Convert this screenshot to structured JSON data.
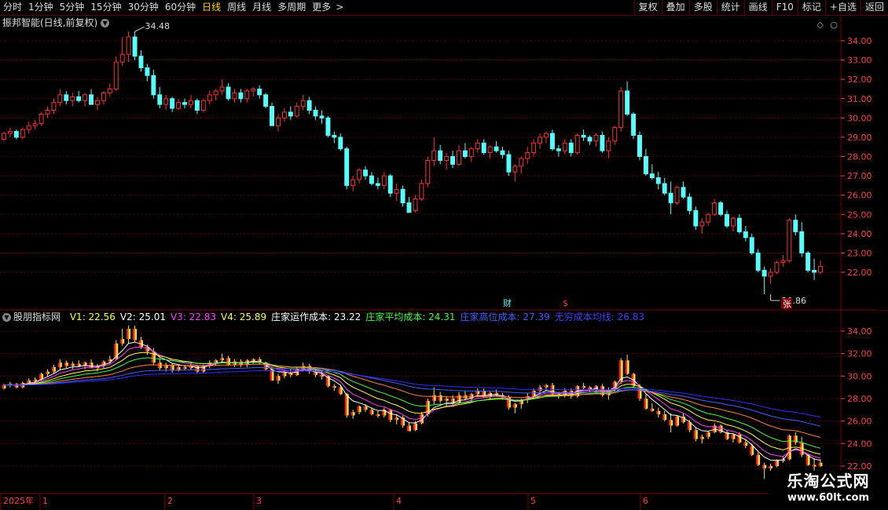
{
  "toolbar": {
    "periods": [
      "分时",
      "1分钟",
      "5分钟",
      "15分钟",
      "30分钟",
      "60分钟",
      "日线",
      "周线",
      "月线",
      "多周期",
      "更多"
    ],
    "active_period": "日线",
    "more_icon": "chevron-right-icon",
    "actions": [
      "复权",
      "叠加",
      "多股",
      "统计",
      "画线",
      "F10",
      "标记",
      "+自选",
      "返回"
    ]
  },
  "main_header": {
    "title": "振邦智能(日线,前复权)",
    "dropdown_icon": "chevron-down-icon"
  },
  "indicator_header": {
    "title": "股朋指标网",
    "items": [
      {
        "label": "V1: 22.56",
        "color": "#ffff40"
      },
      {
        "label": "V2: 25.01",
        "color": "#ffffff"
      },
      {
        "label": "V3: 22.83",
        "color": "#ff40ff"
      },
      {
        "label": "V4: 25.89",
        "color": "#ffff40"
      },
      {
        "label": "庄家运作成本: 23.22",
        "color": "#ffffff"
      },
      {
        "label": "庄家平均成本: 24.31",
        "color": "#40ff40"
      },
      {
        "label": "庄家高位成本: 27.39",
        "color": "#4060ff"
      },
      {
        "label": "无穷成本均线: 26.83",
        "color": "#4040ff"
      }
    ]
  },
  "annotations": {
    "high_label": "34.48",
    "low_label": "20.86",
    "marker_cai": "财",
    "marker_dollar": "$",
    "marker_zhang": "张"
  },
  "price_axis": {
    "main_ticks": [
      "34.00",
      "33.00",
      "32.00",
      "31.00",
      "30.00",
      "29.00",
      "28.00",
      "27.00",
      "26.00",
      "25.00",
      "24.00",
      "23.00",
      "22.00"
    ],
    "sub_ticks": [
      "34.00",
      "32.00",
      "30.00",
      "28.00",
      "26.00",
      "24.00",
      "22.00"
    ]
  },
  "time_axis": {
    "labels": [
      "2025年",
      "1",
      "2",
      "3",
      "4",
      "5",
      "6"
    ]
  },
  "watermark": {
    "line1": "乐淘公式网",
    "line2": "www.60lt.com"
  },
  "colors": {
    "up": "#ff3232",
    "down": "#54ffff",
    "grid": "#7a0000",
    "axis_text": "#ff4040",
    "active": "#ffd400"
  },
  "chart_data": {
    "type": "candlestick",
    "main_ylim": [
      20.5,
      35.0
    ],
    "sub_ylim": [
      21.8,
      35.0
    ],
    "candles": [
      [
        28.9,
        29.3,
        28.8,
        29.2
      ],
      [
        29.2,
        29.5,
        29.0,
        29.3
      ],
      [
        29.3,
        29.4,
        28.9,
        29.0
      ],
      [
        29.0,
        29.5,
        28.9,
        29.4
      ],
      [
        29.4,
        29.8,
        29.2,
        29.6
      ],
      [
        29.6,
        29.9,
        29.4,
        29.7
      ],
      [
        29.7,
        30.3,
        29.6,
        30.2
      ],
      [
        30.2,
        30.6,
        30.0,
        30.4
      ],
      [
        30.4,
        31.0,
        30.2,
        30.8
      ],
      [
        30.8,
        31.5,
        30.6,
        31.2
      ],
      [
        31.2,
        31.4,
        30.7,
        30.9
      ],
      [
        30.9,
        31.3,
        30.6,
        31.1
      ],
      [
        31.1,
        31.4,
        30.8,
        30.9
      ],
      [
        30.9,
        31.3,
        30.6,
        31.2
      ],
      [
        31.2,
        31.5,
        30.9,
        30.7
      ],
      [
        30.7,
        31.1,
        30.4,
        30.9
      ],
      [
        30.9,
        31.4,
        30.7,
        31.3
      ],
      [
        31.3,
        31.8,
        31.1,
        31.5
      ],
      [
        31.5,
        33.2,
        31.4,
        32.9
      ],
      [
        32.9,
        34.2,
        32.7,
        33.3
      ],
      [
        33.3,
        34.5,
        32.9,
        34.2
      ],
      [
        34.2,
        34.48,
        33.0,
        33.2
      ],
      [
        33.2,
        33.5,
        32.4,
        32.6
      ],
      [
        32.6,
        32.8,
        31.9,
        32.2
      ],
      [
        32.2,
        32.5,
        31.0,
        31.2
      ],
      [
        31.2,
        31.6,
        30.5,
        30.7
      ],
      [
        30.7,
        31.2,
        30.4,
        31.0
      ],
      [
        31.0,
        31.1,
        30.3,
        30.5
      ],
      [
        30.5,
        31.0,
        30.4,
        30.8
      ],
      [
        30.8,
        31.0,
        30.5,
        30.7
      ],
      [
        30.7,
        31.2,
        30.5,
        30.9
      ],
      [
        30.9,
        31.0,
        30.2,
        30.4
      ],
      [
        30.4,
        31.0,
        30.3,
        30.9
      ],
      [
        30.9,
        31.4,
        30.7,
        31.2
      ],
      [
        31.2,
        31.5,
        30.9,
        31.4
      ],
      [
        31.4,
        32.0,
        31.2,
        31.6
      ],
      [
        31.6,
        31.8,
        30.9,
        31.0
      ],
      [
        31.0,
        31.5,
        30.8,
        31.3
      ],
      [
        31.3,
        31.5,
        30.8,
        31.0
      ],
      [
        31.0,
        31.5,
        30.8,
        31.4
      ],
      [
        31.4,
        31.6,
        31.1,
        31.5
      ],
      [
        31.5,
        31.7,
        31.0,
        31.2
      ],
      [
        31.2,
        31.3,
        30.5,
        30.6
      ],
      [
        30.6,
        30.8,
        29.6,
        29.6
      ],
      [
        29.6,
        30.2,
        29.3,
        30.0
      ],
      [
        30.0,
        30.5,
        29.8,
        30.3
      ],
      [
        30.3,
        30.6,
        29.9,
        30.1
      ],
      [
        30.1,
        30.8,
        30.0,
        30.6
      ],
      [
        30.6,
        31.2,
        30.4,
        30.9
      ],
      [
        30.9,
        31.1,
        30.2,
        30.4
      ],
      [
        30.4,
        30.6,
        29.9,
        30.1
      ],
      [
        30.1,
        30.4,
        29.7,
        30.0
      ],
      [
        30.0,
        30.1,
        29.0,
        29.1
      ],
      [
        29.1,
        29.3,
        28.7,
        29.0
      ],
      [
        29.0,
        29.2,
        28.3,
        28.4
      ],
      [
        28.4,
        28.5,
        26.3,
        26.5
      ],
      [
        26.5,
        27.0,
        26.2,
        26.8
      ],
      [
        26.8,
        27.4,
        26.6,
        27.3
      ],
      [
        27.3,
        27.5,
        26.8,
        27.0
      ],
      [
        27.0,
        27.2,
        26.5,
        26.6
      ],
      [
        26.6,
        26.9,
        26.3,
        26.5
      ],
      [
        26.5,
        27.2,
        26.3,
        27.0
      ],
      [
        27.0,
        27.1,
        25.9,
        26.1
      ],
      [
        26.1,
        26.6,
        25.7,
        26.3
      ],
      [
        26.3,
        26.5,
        25.4,
        25.6
      ],
      [
        25.6,
        25.9,
        25.1,
        25.1
      ],
      [
        25.2,
        26.0,
        25.1,
        25.8
      ],
      [
        25.8,
        26.8,
        25.7,
        26.6
      ],
      [
        26.6,
        28.0,
        26.4,
        27.8
      ],
      [
        27.8,
        29.0,
        27.5,
        28.3
      ],
      [
        28.3,
        28.6,
        27.6,
        27.8
      ],
      [
        27.8,
        28.2,
        27.3,
        28.0
      ],
      [
        28.0,
        28.3,
        27.4,
        27.6
      ],
      [
        27.6,
        28.6,
        27.5,
        28.3
      ],
      [
        28.3,
        28.7,
        27.9,
        28.0
      ],
      [
        28.0,
        28.5,
        27.7,
        28.4
      ],
      [
        28.4,
        28.9,
        28.2,
        28.7
      ],
      [
        28.7,
        28.9,
        28.1,
        28.2
      ],
      [
        28.2,
        28.6,
        27.9,
        28.5
      ],
      [
        28.5,
        28.8,
        28.2,
        28.3
      ],
      [
        28.3,
        28.5,
        27.9,
        28.1
      ],
      [
        28.1,
        28.3,
        27.0,
        27.2
      ],
      [
        27.2,
        27.6,
        26.7,
        27.5
      ],
      [
        27.5,
        28.0,
        27.1,
        27.9
      ],
      [
        27.9,
        28.5,
        27.6,
        28.2
      ],
      [
        28.2,
        28.9,
        28.0,
        28.7
      ],
      [
        28.7,
        29.2,
        28.4,
        29.0
      ],
      [
        29.0,
        29.3,
        28.7,
        29.2
      ],
      [
        29.2,
        29.4,
        28.3,
        28.4
      ],
      [
        28.4,
        28.6,
        28.0,
        28.3
      ],
      [
        28.3,
        28.9,
        28.1,
        28.7
      ],
      [
        28.7,
        28.9,
        28.0,
        28.2
      ],
      [
        28.2,
        29.2,
        28.1,
        29.1
      ],
      [
        29.1,
        29.4,
        28.8,
        29.0
      ],
      [
        29.0,
        29.1,
        28.6,
        28.8
      ],
      [
        28.8,
        29.2,
        28.5,
        29.1
      ],
      [
        29.1,
        29.3,
        28.2,
        28.3
      ],
      [
        28.3,
        29.0,
        27.9,
        28.8
      ],
      [
        28.8,
        29.6,
        28.6,
        29.5
      ],
      [
        29.5,
        31.6,
        29.3,
        31.4
      ],
      [
        31.4,
        31.9,
        30.1,
        30.2
      ],
      [
        30.2,
        30.3,
        28.9,
        29.1
      ],
      [
        29.1,
        29.3,
        27.8,
        28.0
      ],
      [
        28.0,
        28.4,
        27.0,
        27.1
      ],
      [
        27.1,
        27.6,
        26.8,
        26.9
      ],
      [
        26.9,
        27.2,
        26.3,
        26.6
      ],
      [
        26.6,
        26.9,
        26.0,
        26.1
      ],
      [
        26.1,
        26.7,
        25.0,
        25.6
      ],
      [
        25.6,
        26.5,
        25.5,
        26.4
      ],
      [
        26.4,
        26.7,
        25.8,
        25.9
      ],
      [
        25.9,
        26.1,
        25.0,
        25.2
      ],
      [
        25.2,
        25.4,
        24.2,
        24.4
      ],
      [
        24.4,
        24.8,
        24.0,
        24.6
      ],
      [
        24.6,
        25.1,
        24.4,
        25.0
      ],
      [
        25.0,
        25.8,
        24.9,
        25.6
      ],
      [
        25.6,
        25.7,
        24.9,
        25.0
      ],
      [
        25.0,
        25.2,
        24.3,
        24.4
      ],
      [
        24.4,
        24.9,
        24.1,
        24.8
      ],
      [
        24.8,
        25.0,
        24.0,
        24.1
      ],
      [
        24.1,
        24.4,
        23.6,
        23.8
      ],
      [
        23.8,
        24.0,
        22.9,
        23.0
      ],
      [
        23.0,
        23.2,
        22.0,
        22.1
      ],
      [
        22.1,
        22.3,
        20.86,
        21.8
      ],
      [
        21.8,
        22.2,
        21.4,
        22.0
      ],
      [
        22.0,
        22.6,
        21.9,
        22.5
      ],
      [
        22.5,
        22.9,
        22.3,
        22.6
      ],
      [
        22.6,
        24.8,
        22.5,
        24.7
      ],
      [
        24.7,
        25.0,
        23.9,
        24.1
      ],
      [
        24.1,
        24.6,
        22.8,
        23.0
      ],
      [
        23.0,
        23.1,
        22.0,
        22.1
      ],
      [
        22.1,
        22.7,
        21.6,
        22.0
      ],
      [
        22.0,
        22.6,
        21.9,
        22.3
      ]
    ]
  }
}
